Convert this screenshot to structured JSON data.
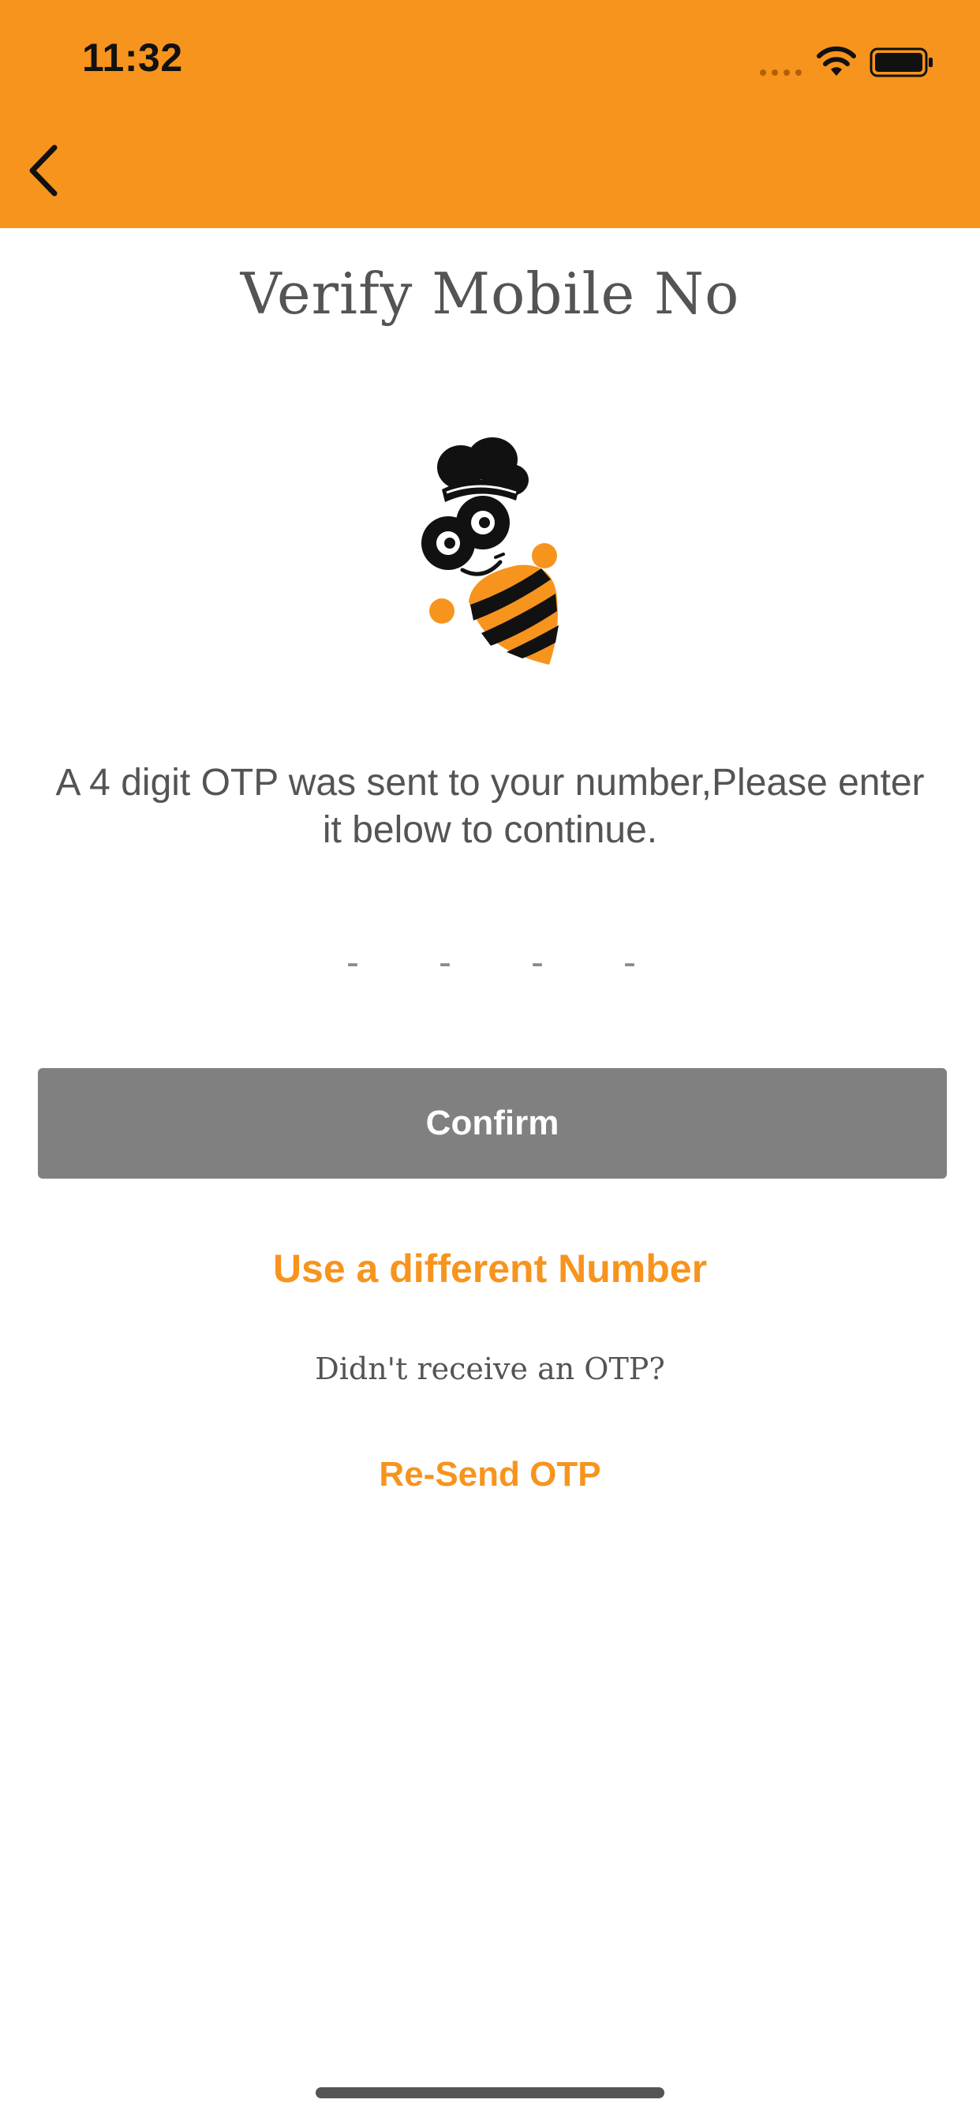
{
  "status_bar": {
    "time": "11:32",
    "icons": [
      "signal-icon",
      "wifi-icon",
      "battery-icon"
    ]
  },
  "header": {
    "back_icon": "chevron-left-icon",
    "color": "#F7941D"
  },
  "page": {
    "title": "Verify Mobile No",
    "message": "A 4 digit OTP was sent to your number,Please enter it below to continue.",
    "mascot_icon": "bee-chef-mascot"
  },
  "otp": {
    "digits": [
      {
        "value": "",
        "placeholder": "-"
      },
      {
        "value": "",
        "placeholder": "-"
      },
      {
        "value": "",
        "placeholder": "-"
      },
      {
        "value": "",
        "placeholder": "-"
      }
    ]
  },
  "actions": {
    "confirm_label": "Confirm",
    "different_number_label": "Use a different Number",
    "no_otp_text": "Didn't receive an OTP?",
    "resend_label": "Re-Send OTP"
  },
  "colors": {
    "accent": "#F7941D",
    "button_disabled": "#808080",
    "text": "#545454"
  }
}
